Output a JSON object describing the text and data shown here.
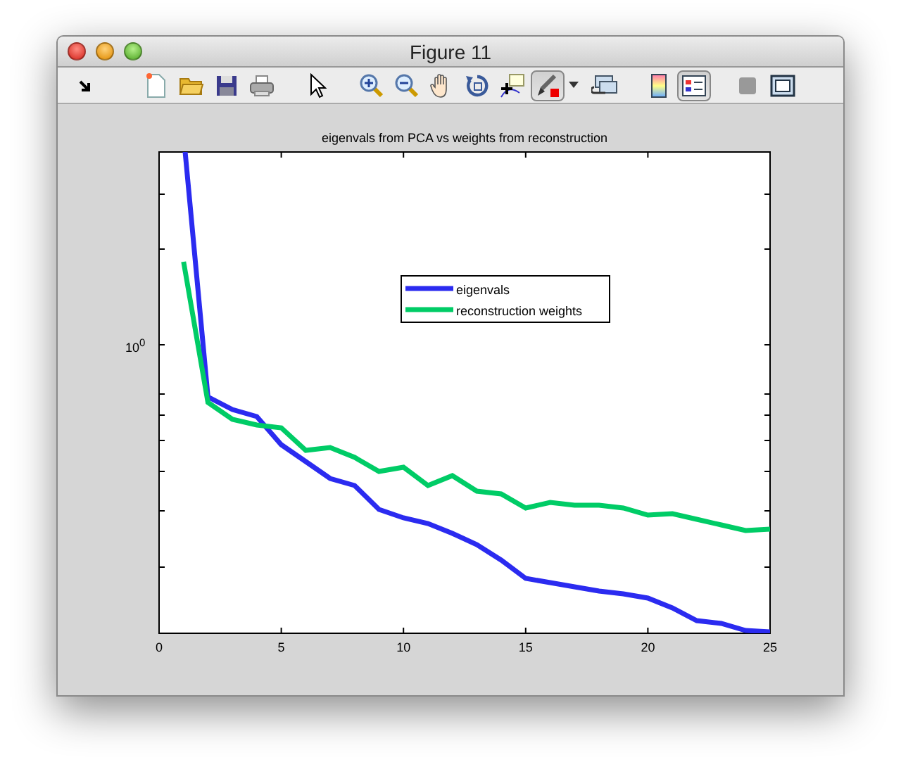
{
  "window": {
    "title": "Figure 11"
  },
  "toolbar": [
    {
      "kind": "dock",
      "pressed": false
    },
    {
      "kind": "new",
      "pressed": false
    },
    {
      "kind": "open",
      "pressed": false
    },
    {
      "kind": "save",
      "pressed": false
    },
    {
      "kind": "print",
      "pressed": false
    },
    {
      "kind": "pointer",
      "pressed": false
    },
    {
      "kind": "zoom-in",
      "pressed": false
    },
    {
      "kind": "zoom-out",
      "pressed": false
    },
    {
      "kind": "pan",
      "pressed": false
    },
    {
      "kind": "rotate",
      "pressed": false
    },
    {
      "kind": "data-cursor",
      "pressed": false
    },
    {
      "kind": "brush",
      "pressed": true
    },
    {
      "kind": "menu-caret",
      "pressed": false
    },
    {
      "kind": "link",
      "pressed": false
    },
    {
      "kind": "colorbar",
      "pressed": false
    },
    {
      "kind": "legend",
      "pressed": true
    },
    {
      "kind": "hide-tools",
      "pressed": false
    },
    {
      "kind": "show-tools",
      "pressed": false
    }
  ],
  "plot": {
    "title": "eigenvals from PCA vs weights from reconstruction",
    "ytick_labels": [
      "10$^{0}$"
    ],
    "xtick_labels": [
      "0",
      "5",
      "10",
      "15",
      "20",
      "25"
    ],
    "legend": [
      {
        "label": "eigenvals",
        "color": "#2b2bf0"
      },
      {
        "label": "reconstruction weights",
        "color": "#00cc66"
      }
    ]
  }
}
